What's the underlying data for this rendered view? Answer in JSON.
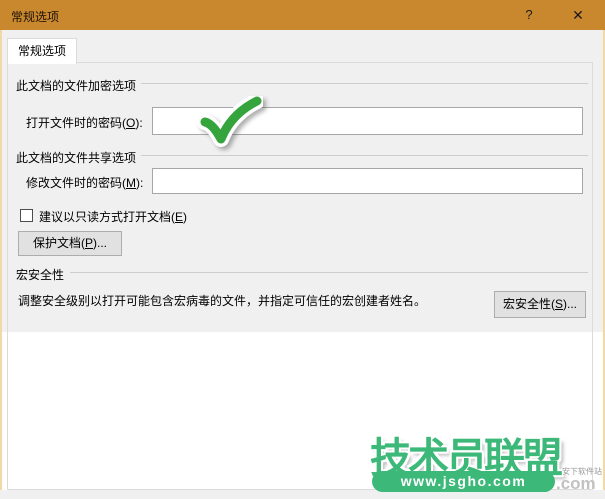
{
  "title_bar": {
    "title": "常规选项",
    "help_glyph": "?",
    "close_glyph": "✕"
  },
  "tab": {
    "label": "常规选项"
  },
  "encryption_section": {
    "title": "此文档的文件加密选项",
    "open_password_label_pre": "打开文件时的密码(",
    "open_password_key": "O",
    "open_password_label_post": "):",
    "open_password_value": ""
  },
  "sharing_section": {
    "title": "此文档的文件共享选项",
    "modify_password_label_pre": "修改文件时的密码(",
    "modify_password_key": "M",
    "modify_password_label_post": "):",
    "modify_password_value": "",
    "readonly_checkbox_pre": "建议以只读方式打开文档(",
    "readonly_checkbox_key": "E",
    "readonly_checkbox_post": ")",
    "protect_button_pre": "保护文档(",
    "protect_button_key": "P",
    "protect_button_post": ")..."
  },
  "macro_section": {
    "title": "宏安全性",
    "description": "调整安全级别以打开可能包含宏病毒的文件，并指定可信任的宏创建者姓名。",
    "macro_button_pre": "宏安全性(",
    "macro_button_key": "S",
    "macro_button_post": ")..."
  },
  "watermark": {
    "logo_text": "技术员联盟",
    "url": "www.jsgho.com",
    "side_text": "安下软件站",
    "side_text2": ".com"
  },
  "colors": {
    "titlebar": "#C9882E",
    "window_edge": "#F2D8A4",
    "logo_green": "#3CB878",
    "check_green": "#35A43C"
  }
}
